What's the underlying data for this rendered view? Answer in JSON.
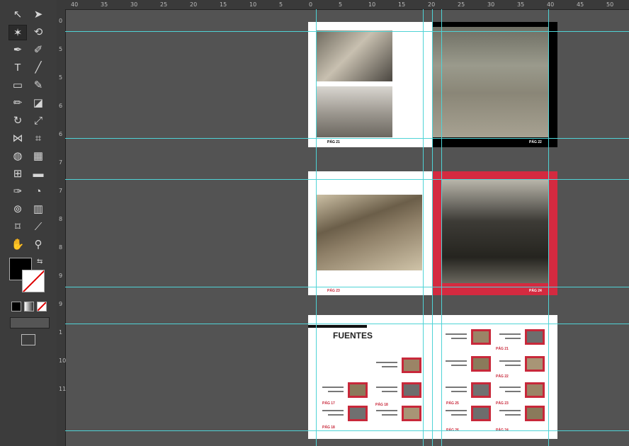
{
  "ruler_top": {
    "labels": [
      "40",
      "35",
      "30",
      "25",
      "20",
      "15",
      "10",
      "5",
      "0",
      "5",
      "10",
      "15",
      "20",
      "25",
      "30",
      "35",
      "40",
      "45",
      "50"
    ]
  },
  "ruler_left": {
    "labels": [
      "0",
      "5",
      "5",
      "6",
      "6",
      "7",
      "7",
      "8",
      "8",
      "9",
      "9",
      "1",
      "10",
      "11"
    ]
  },
  "toolbar": {
    "tools": [
      {
        "name": "selection-tool-icon",
        "glyph": "↖"
      },
      {
        "name": "direct-selection-tool-icon",
        "glyph": "➤"
      },
      {
        "name": "magic-wand-tool-icon",
        "glyph": "✶"
      },
      {
        "name": "lasso-tool-icon",
        "glyph": "⟲"
      },
      {
        "name": "pen-tool-icon",
        "glyph": "✒"
      },
      {
        "name": "curvature-tool-icon",
        "glyph": "✐"
      },
      {
        "name": "type-tool-icon",
        "glyph": "T"
      },
      {
        "name": "line-tool-icon",
        "glyph": "╱"
      },
      {
        "name": "rectangle-tool-icon",
        "glyph": "▭"
      },
      {
        "name": "paintbrush-tool-icon",
        "glyph": "✎"
      },
      {
        "name": "pencil-tool-icon",
        "glyph": "✏"
      },
      {
        "name": "eraser-tool-icon",
        "glyph": "◪"
      },
      {
        "name": "rotate-tool-icon",
        "glyph": "↻"
      },
      {
        "name": "scale-tool-icon",
        "glyph": "⤢"
      },
      {
        "name": "width-tool-icon",
        "glyph": "⋈"
      },
      {
        "name": "free-transform-tool-icon",
        "glyph": "⌗"
      },
      {
        "name": "shape-builder-tool-icon",
        "glyph": "◍"
      },
      {
        "name": "perspective-grid-tool-icon",
        "glyph": "▦"
      },
      {
        "name": "mesh-tool-icon",
        "glyph": "⊞"
      },
      {
        "name": "gradient-tool-icon",
        "glyph": "▬"
      },
      {
        "name": "eyedropper-tool-icon",
        "glyph": "✑"
      },
      {
        "name": "blend-tool-icon",
        "glyph": "◔"
      },
      {
        "name": "symbol-sprayer-tool-icon",
        "glyph": "⊚"
      },
      {
        "name": "column-graph-tool-icon",
        "glyph": "▥"
      },
      {
        "name": "artboard-tool-icon",
        "glyph": "⌑"
      },
      {
        "name": "slice-tool-icon",
        "glyph": "⟋"
      },
      {
        "name": "hand-tool-icon",
        "glyph": "✋"
      },
      {
        "name": "zoom-tool-icon",
        "glyph": "⚲"
      }
    ]
  },
  "colors": {
    "accent_red": "#c8283a",
    "guide": "#4fd3d6"
  },
  "spread1": {
    "page_left": "PÁG 21",
    "page_right": "PÁG 22"
  },
  "spread2": {
    "page_left": "PÁG 23",
    "page_right": "PÁG 24"
  },
  "spread3": {
    "title": "FUENTES",
    "page_labels": [
      "PÁG 17",
      "PÁG 18",
      "PÁG 18",
      "PÁG 21",
      "PÁG 22",
      "PÁG 23",
      "PÁG 24",
      "PÁG 25",
      "PÁG 26"
    ]
  }
}
